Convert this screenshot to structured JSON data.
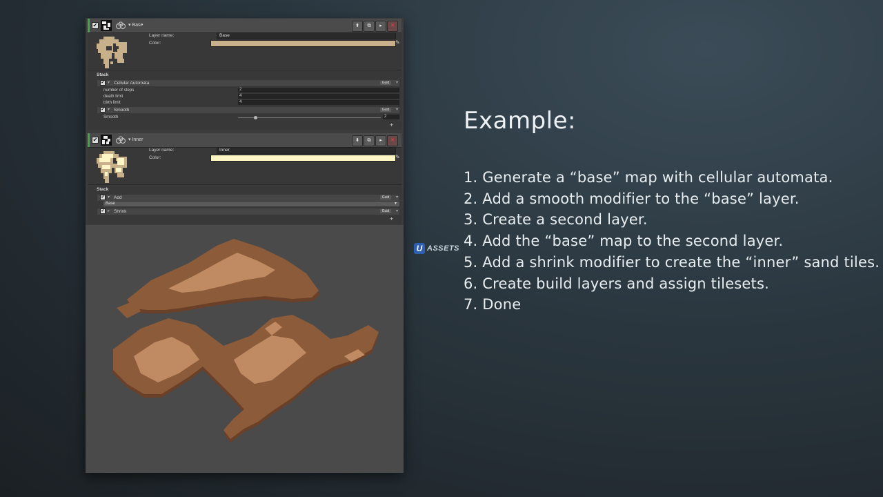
{
  "layers": [
    {
      "title": "Base",
      "layer_name_label": "Layer name:",
      "layer_name_value": "Base",
      "color_label": "Color:",
      "color": "#c8b08a",
      "stack_label": "Stack",
      "modifiers": [
        {
          "title": "Cellular Automata",
          "guid_label": "Guid",
          "params": [
            {
              "label": "number of steps",
              "value": "2"
            },
            {
              "label": "death limit",
              "value": "4"
            },
            {
              "label": "birth limit",
              "value": "4"
            }
          ]
        },
        {
          "title": "Smooth",
          "guid_label": "Guid",
          "slider": {
            "label": "Smooth",
            "value": "2",
            "fraction": 0.12
          }
        }
      ],
      "add_label": "+"
    },
    {
      "title": "Inner",
      "layer_name_label": "Layer name:",
      "layer_name_value": "Inner",
      "color_label": "Color:",
      "color": "#fff6c8",
      "stack_label": "Stack",
      "modifiers": [
        {
          "title": "Add",
          "guid_label": "Guid",
          "dropdown": "Base"
        },
        {
          "title": "Shrink",
          "guid_label": "Guid"
        }
      ],
      "add_label": "+"
    }
  ],
  "header_buttons": [
    "⬍",
    "⧉",
    "▸",
    "✕"
  ],
  "watermark": {
    "badge": "U",
    "text": "ASSETS"
  },
  "example": {
    "title": "Example:",
    "steps": [
      "1. Generate a “base” map with cellular automata.",
      "2. Add a smooth modifier to the “base” layer.",
      "3. Create a second layer.",
      "4. Add the “base” map to the second layer.",
      "5. Add a shrink modifier to create the “inner” sand tiles.",
      "6. Create build layers and assign tilesets.",
      "7. Done"
    ]
  },
  "colors": {
    "accent_green": "#3ea84a",
    "map_base": "#8c5c3a",
    "map_inner": "#c08a62",
    "map_edge": "#6b4028",
    "map_background": "#4a4a4a"
  },
  "icons": [
    "check-icon",
    "link-icon",
    "fold-icon",
    "move-icon",
    "duplicate-icon",
    "play-icon",
    "delete-icon",
    "color-picker-icon",
    "add-icon"
  ]
}
